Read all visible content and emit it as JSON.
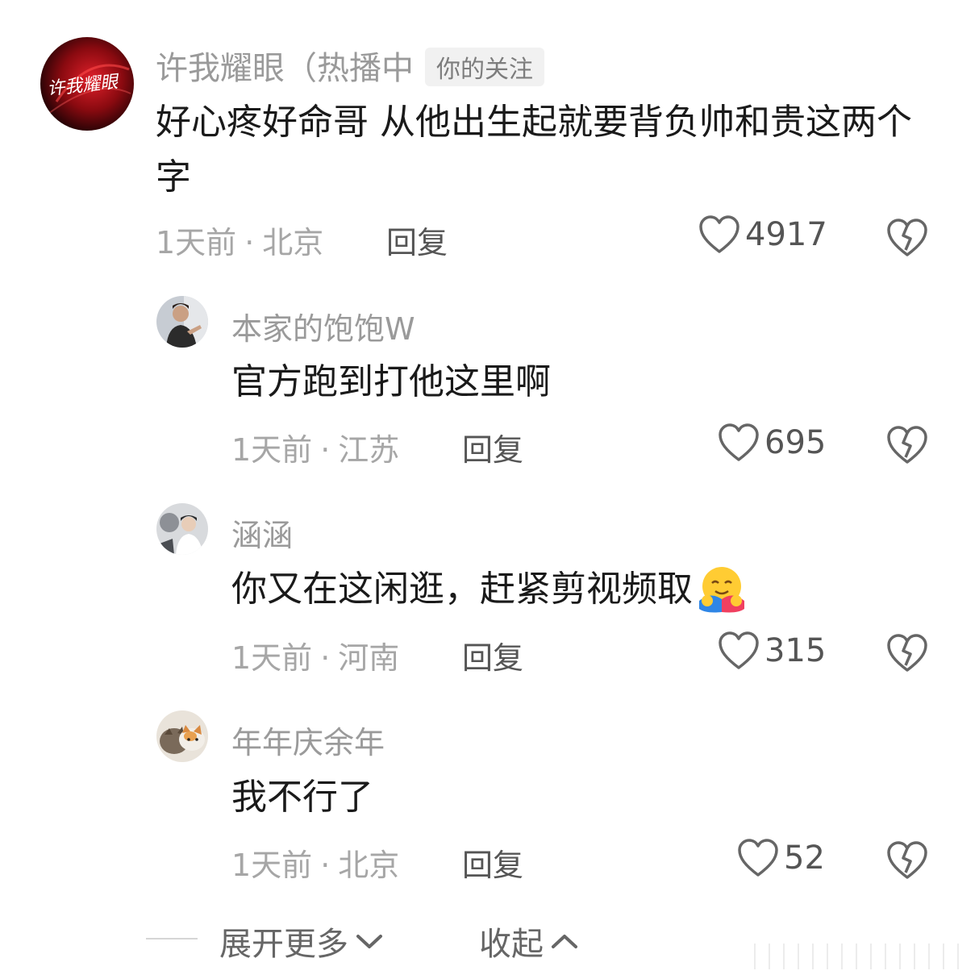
{
  "comments": [
    {
      "username": "许我耀眼（热播中",
      "tag": "你的关注",
      "avatar_label": "许我耀眼",
      "text": "好心疼好命哥 从他出生起就要背负帅和贵这两个字",
      "time": "1天前",
      "location": "北京",
      "reply_label": "回复",
      "likes": "4917"
    },
    {
      "username": "本家的饱饱W",
      "text": "官方跑到打他这里啊",
      "time": "1天前",
      "location": "江苏",
      "reply_label": "回复",
      "likes": "695"
    },
    {
      "username": "涵涵",
      "text": "你又在这闲逛，赶紧剪视频取",
      "time": "1天前",
      "location": "河南",
      "reply_label": "回复",
      "likes": "315"
    },
    {
      "username": "年年庆余年",
      "text": "我不行了",
      "time": "1天前",
      "location": "北京",
      "reply_label": "回复",
      "likes": "52"
    }
  ],
  "footer": {
    "expand_label": "展开更多",
    "collapse_label": "收起"
  },
  "icons": {
    "like": "heart-outline-icon",
    "dislike": "broken-heart-icon",
    "expand": "chevron-down-icon",
    "collapse": "chevron-up-icon",
    "emoji": "hug-emoji"
  },
  "colors": {
    "username": "#9a9a9a",
    "text": "#1a1a1a",
    "meta": "#a6a6a6",
    "accent_avatar": "#c4121b"
  }
}
